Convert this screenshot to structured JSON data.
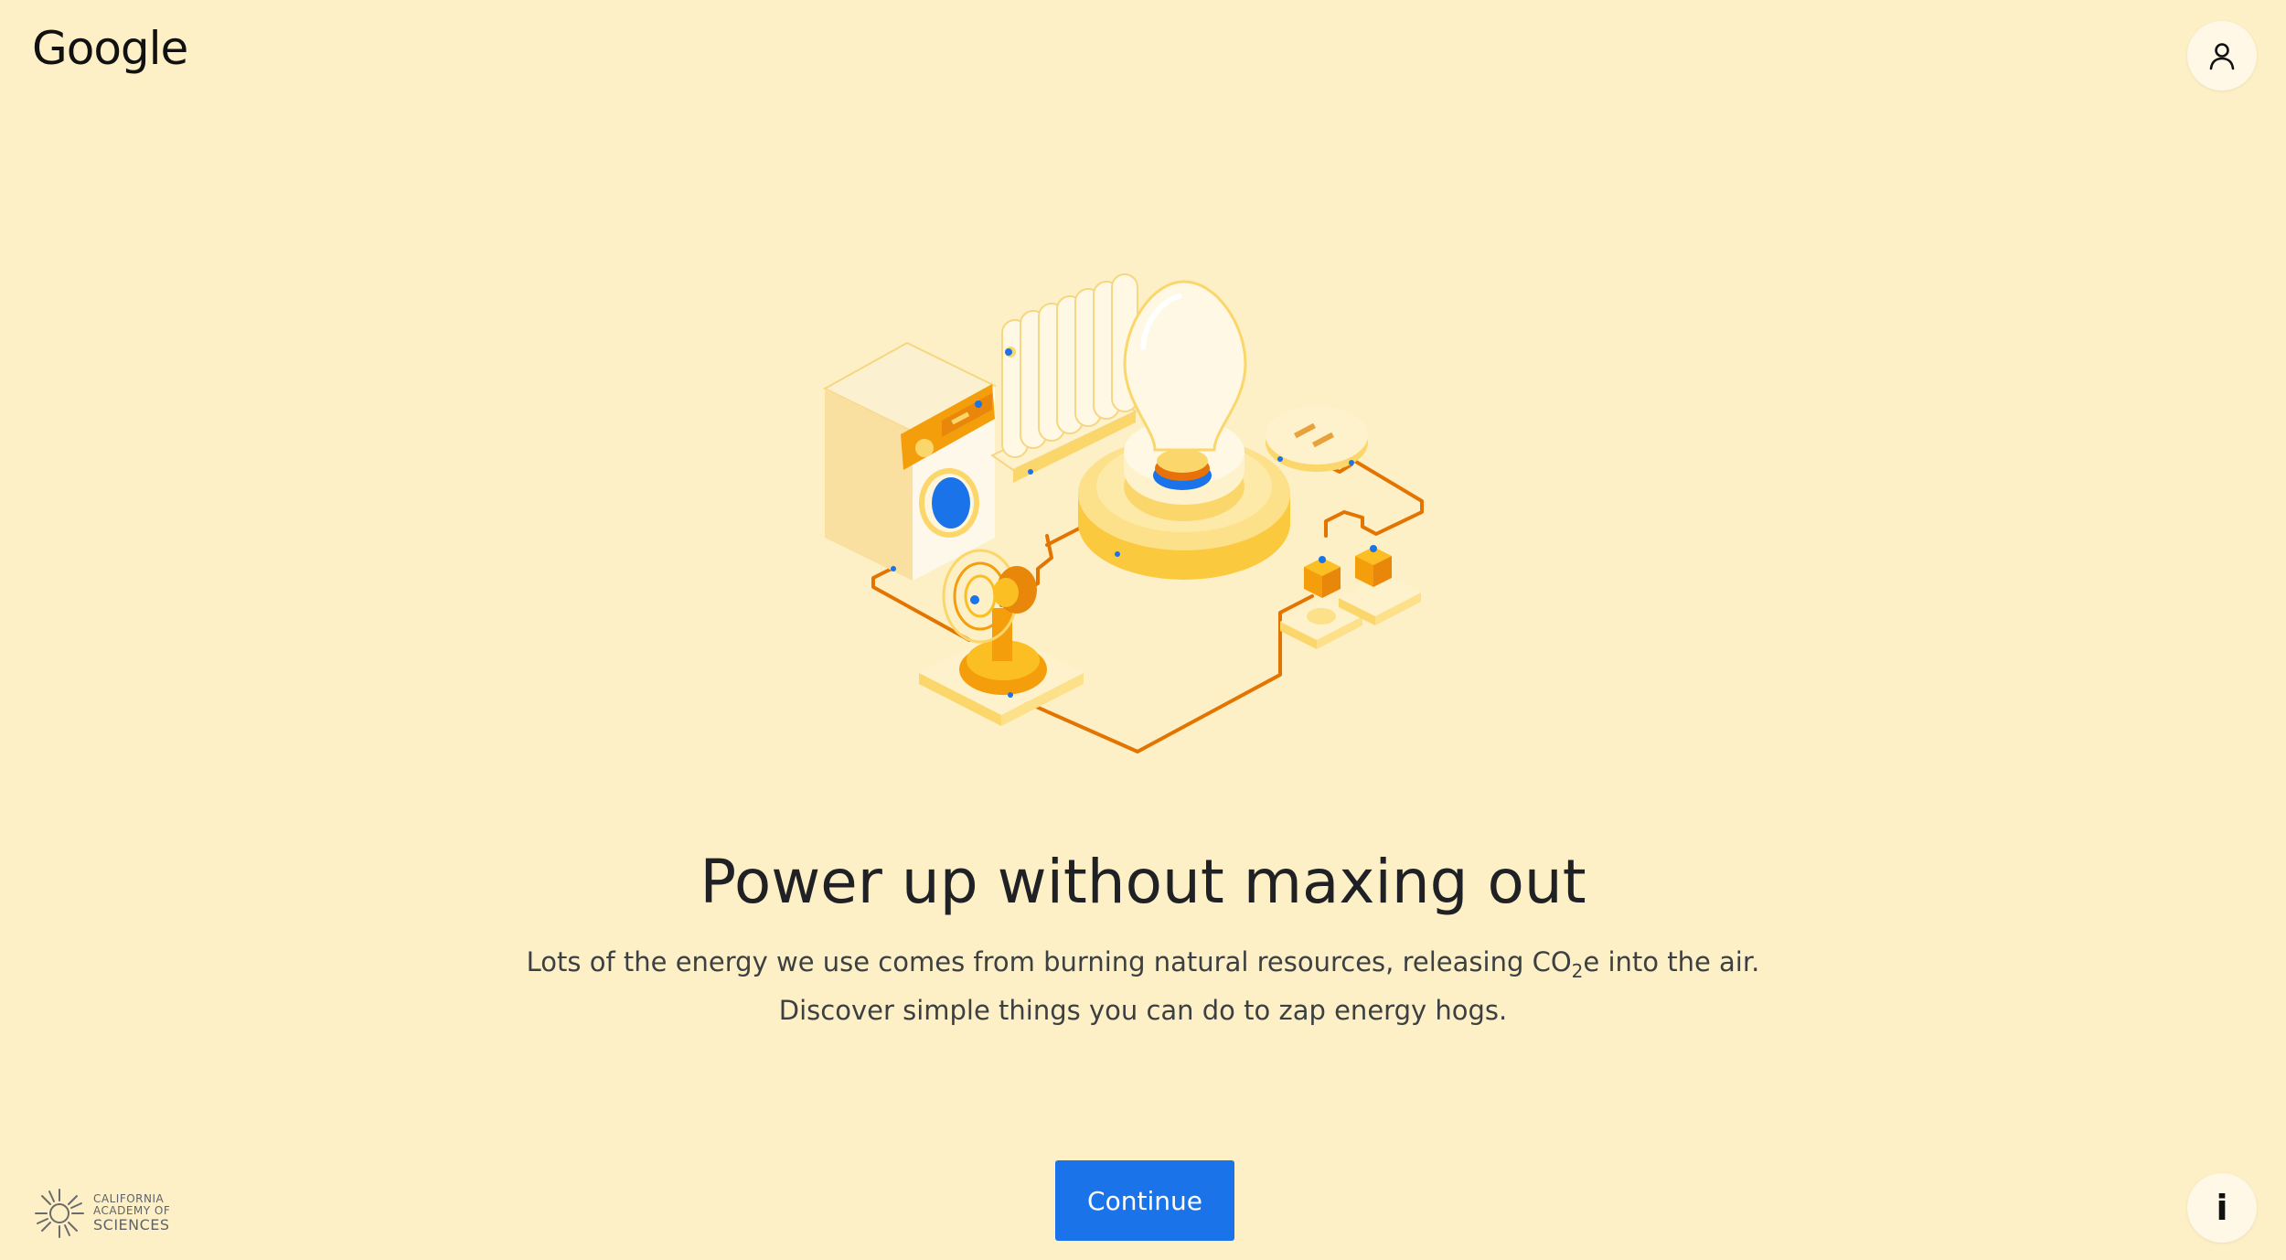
{
  "header": {
    "logo_text": "Google",
    "account_icon": "person-icon"
  },
  "main": {
    "illustration_icon": "energy-appliances-illustration",
    "headline": "Power up without maxing out",
    "body": {
      "line1_before": "Lots of the energy we use comes from burning natural resources, releasing CO",
      "line1_sub": "2",
      "line1_after": "e into the air.",
      "line2": "Discover simple things you can do to zap energy hogs."
    },
    "continue_label": "Continue"
  },
  "footer": {
    "partner_line1": "CALIFORNIA",
    "partner_line2": "ACADEMY OF",
    "partner_line3": "SCIENCES",
    "partner_icon": "california-academy-of-sciences-logo",
    "info_glyph": "i",
    "info_icon": "info-icon"
  },
  "colors": {
    "background": "#fef0c6",
    "button": "#1a73e8",
    "wire": "#e37400",
    "accent_blue": "#1a73e8"
  }
}
